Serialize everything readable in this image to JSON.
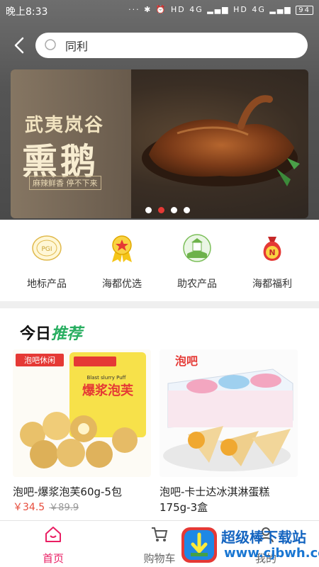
{
  "status_bar": {
    "time": "晚上8:33",
    "icons": "··· ✱ ⏰ HD 4G ▂▄▆ HD 4G ▂▄▆",
    "battery": "94"
  },
  "search": {
    "value": "同利"
  },
  "banner": {
    "line1": "武夷岚谷",
    "line2": "熏鹅",
    "tagline": "麻辣鲜香 停不下来",
    "dot_count": 4,
    "active_dot": 1
  },
  "categories": [
    {
      "label": "地标产品",
      "icon": "landmark-badge-icon"
    },
    {
      "label": "海都优选",
      "icon": "medal-star-icon"
    },
    {
      "label": "助农产品",
      "icon": "farm-wheat-icon"
    },
    {
      "label": "海都福利",
      "icon": "money-bag-icon"
    }
  ],
  "recommend": {
    "title_black": "今日",
    "title_green": "推荐",
    "products": [
      {
        "name": "泡吧-爆浆泡芙60g-5包",
        "price": "￥34.5",
        "old_price": "￥89.9",
        "brand": "泡吧休闲",
        "package_text": "爆浆泡芙",
        "package_sub": "Blast slurry Puff"
      },
      {
        "name": "泡吧-卡士达冰淇淋蛋糕175g-3盒",
        "price": "",
        "old_price": "",
        "brand": "泡吧",
        "package_text": "",
        "package_sub": ""
      }
    ]
  },
  "nav": {
    "items": [
      {
        "label": "首页",
        "icon": "home-icon",
        "active": true
      },
      {
        "label": "购物车",
        "icon": "cart-icon",
        "active": false
      },
      {
        "label": "我的",
        "icon": "user-icon",
        "active": false
      }
    ]
  },
  "watermark": {
    "text": "超级棒下载站",
    "url": "www.cjbwh.com"
  },
  "colors": {
    "accent": "#e91e63",
    "price": "#e74c3c",
    "reco_green": "#27ae60",
    "active_dot": "#e53935"
  }
}
